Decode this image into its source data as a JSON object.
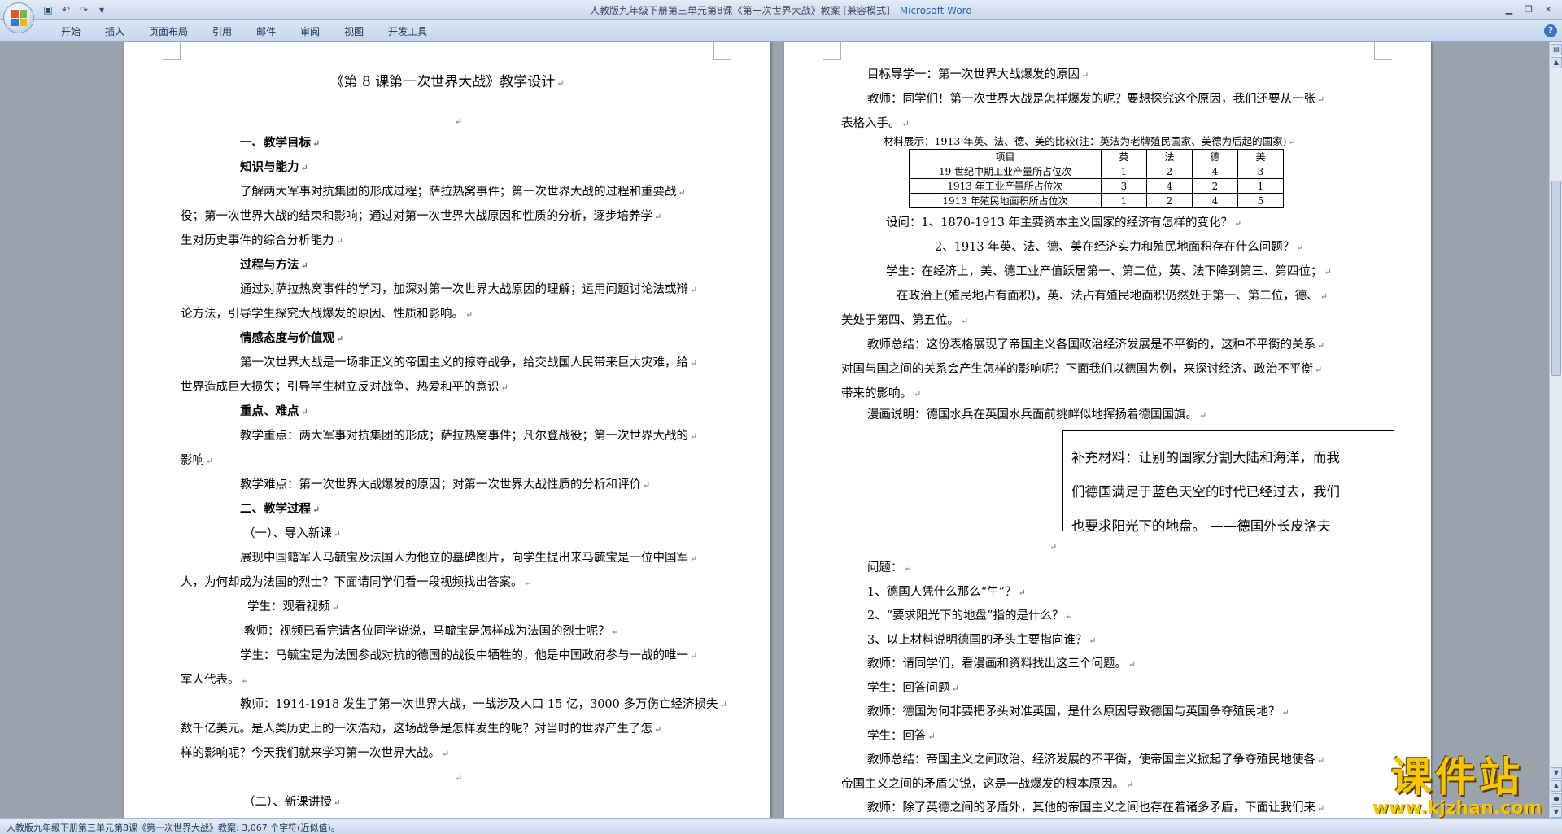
{
  "titlebar": {
    "title": "人教版九年级下册第三单元第8课《第一次世界大战》教案 [兼容模式] - ",
    "app_name": "Microsoft Word"
  },
  "ribbon": {
    "tabs": [
      "开始",
      "插入",
      "页面布局",
      "引用",
      "邮件",
      "审阅",
      "视图",
      "开发工具"
    ]
  },
  "left_page": {
    "title": "《第 8 课第一次世界大战》教学设计",
    "lines": [
      {
        "text": "",
        "x": 0,
        "y": 0,
        "bold": false
      },
      {
        "text": "一、教学目标",
        "bold": true
      },
      {
        "text": "知识与能力",
        "bold": true
      },
      {
        "text": "了解两大军事对抗集团的形成过程；萨拉热窝事件；第一次世界大战的过程和重要战",
        "bold": false
      },
      {
        "text": "役；第一次世界大战的结束和影响；通过对第一次世界大战原因和性质的分析，逐步培养学",
        "bold": false
      },
      {
        "text": "生对历史事件的综合分析能力",
        "bold": false
      },
      {
        "text": "过程与方法",
        "bold": true
      },
      {
        "text": "通过对萨拉热窝事件的学习，加深对第一次世界大战原因的理解；运用问题讨论法或辩",
        "bold": false
      },
      {
        "text": "论方法，引导学生探究大战爆发的原因、性质和影响。",
        "bold": false
      },
      {
        "text": "情感态度与价值观",
        "bold": true
      },
      {
        "text": "第一次世界大战是一场非正义的帝国主义的掠夺战争，给交战国人民带来巨大灾难，给",
        "bold": false
      },
      {
        "text": "世界造成巨大损失；引导学生树立反对战争、热爱和平的意识",
        "bold": false
      },
      {
        "text": "重点、难点",
        "bold": true
      },
      {
        "text": "教学重点：两大军事对抗集团的形成；萨拉热窝事件；凡尔登战役；第一次世界大战的",
        "bold": false
      },
      {
        "text": "影响",
        "bold": false
      },
      {
        "text": "教学难点：第一次世界大战爆发的原因；对第一次世界大战性质的分析和评价",
        "bold": false
      },
      {
        "text": "二、教学过程",
        "bold": true
      },
      {
        "text": "（一）、导入新课",
        "bold": false
      },
      {
        "text": "展现中国籍军人马毓宝及法国人为他立的墓碑图片，向学生提出来马毓宝是一位中国军",
        "bold": false
      },
      {
        "text": "人，为何却成为法国的烈士？下面请同学们看一段视频找出答案。",
        "bold": false
      },
      {
        "text": "学生：观看视频",
        "bold": false
      },
      {
        "text": "教师：视频已看完请各位同学说说，马毓宝是怎样成为法国的烈士呢？",
        "bold": false
      },
      {
        "text": "学生：马毓宝是为法国参战对抗的德国的战役中牺牲的，他是中国政府参与一战的唯一",
        "bold": false
      },
      {
        "text": "军人代表。",
        "bold": false
      },
      {
        "text": "教师：1914-1918 发生了第一次世界大战，一战涉及人口 15 亿，3000 多万伤亡经济损失",
        "bold": false
      },
      {
        "text": "数千亿美元。是人类历史上的一次浩劫，这场战争是怎样发生的呢？对当时的世界产生了怎",
        "bold": false
      },
      {
        "text": "样的影响呢？今天我们就来学习第一次世界大战。",
        "bold": false
      },
      {
        "text": "",
        "bold": false
      },
      {
        "text": "（二）、新课讲授",
        "bold": false
      }
    ]
  },
  "right_page": {
    "lines_top": [
      "目标导学一：第一次世界大战爆发的原因",
      "教师：同学们！第一次世界大战是怎样爆发的呢？要想探究这个原因，我们还要从一张",
      "表格入手。",
      "材料展示：1913 年英、法、德、美的比较(注：英法为老牌殖民国家、美德为后起的国家)"
    ],
    "table": {
      "header": [
        "项目",
        "英",
        "法",
        "德",
        "美"
      ],
      "rows": [
        [
          "19 世纪中期工业产量所占位次",
          "1",
          "2",
          "4",
          "3"
        ],
        [
          "1913 年工业产量所占位次",
          "3",
          "4",
          "2",
          "1"
        ],
        [
          "1913 年殖民地面积所占位次",
          "1",
          "2",
          "4",
          "5"
        ]
      ]
    },
    "lines_mid": [
      "设问：1、1870-1913 年主要资本主义国家的经济有怎样的变化？",
      "2、1913 年英、法、德、美在经济实力和殖民地面积存在什么问题？",
      "学生：在经济上，美、德工业产值跃居第一、第二位，英、法下降到第三、第四位；",
      "在政治上(殖民地占有面积)，英、法占有殖民地面积仍然处于第一、第二位，德、",
      "美处于第四、第五位。",
      "教师总结：这份表格展现了帝国主义各国政治经济发展是不平衡的，这种不平衡的关系",
      "对国与国之间的关系会产生怎样的影响呢？下面我们以德国为例，来探讨经济、政治不平衡",
      "带来的影响。",
      "漫画说明：德国水兵在英国水兵面前挑衅似地挥扬着德国国旗。"
    ],
    "box_lines": [
      "补充材料：让别的国家分割大陆和海洋，而我",
      "们德国满足于蓝色天空的时代已经过去，我们",
      "也要求阳光下的地盘。  ——德国外长皮洛夫"
    ],
    "lines_bottom": [
      "问题：",
      "1、德国人凭什么那么“牛”？",
      "2、“要求阳光下的地盘”指的是什么？",
      "3、以上材料说明德国的矛头主要指向谁？",
      "教师：请同学们，看漫画和资料找出这三个问题。",
      "学生：回答问题",
      "教师：德国为何非要把矛头对准英国，是什么原因导致德国与英国争夺殖民地？",
      "学生：回答",
      "教师总结：帝国主义之间政治、经济发展的不平衡，使帝国主义掀起了争夺殖民地使各",
      "帝国主义之间的矛盾尖锐，这是一战爆发的根本原因。",
      "教师：除了英德之间的矛盾外，其他的帝国主义之间也存在着诸多矛盾，下面让我们来"
    ]
  },
  "statusbar": {
    "text": "人教版九年级下册第三单元第8课《第一次世界大战》教案: 3,067 个字符(近似值)。"
  },
  "watermark": {
    "big": "课件站",
    "small": "www.kjzhan.com"
  }
}
